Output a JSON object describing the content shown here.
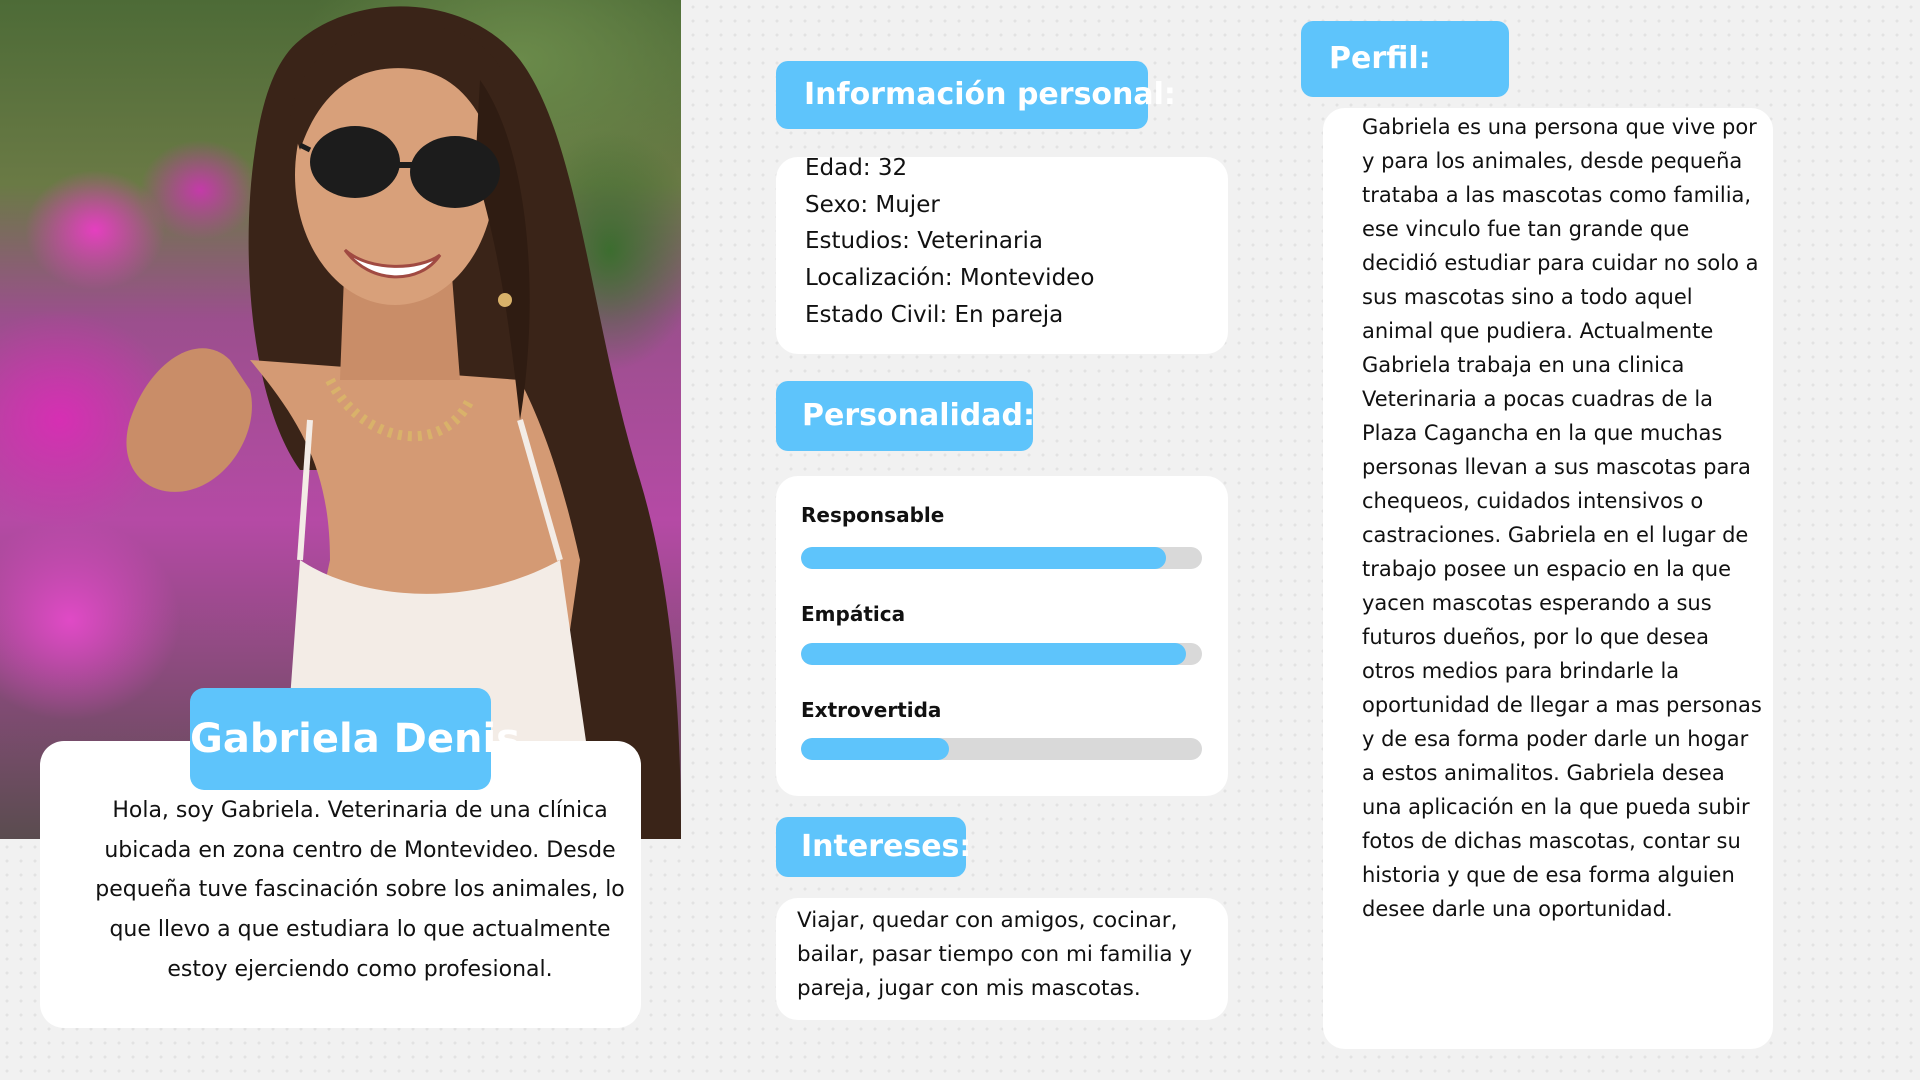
{
  "colors": {
    "accent": "#5ec4fb",
    "card": "#ffffff",
    "bar_track": "#d9d9d9",
    "text": "#111111"
  },
  "name": "Gabriela Denis",
  "bio": "Hola, soy Gabriela. Veterinaria de una clínica ubicada en zona centro de Montevideo. Desde pequeña tuve fascinación sobre los animales, lo que llevo a que estudiara lo que actualmente estoy ejerciendo como profesional.",
  "personal_info": {
    "title": "Información personal:",
    "items": [
      "Edad: 32",
      "Sexo: Mujer",
      "Estudios: Veterinaria",
      "Localización: Montevideo",
      "Estado Civil: En pareja"
    ]
  },
  "personality": {
    "title": "Personalidad:",
    "traits": [
      {
        "label": "Responsable",
        "level": 0.91
      },
      {
        "label": "Empática",
        "level": 0.96
      },
      {
        "label": "Extrovertida",
        "level": 0.37
      }
    ]
  },
  "interests": {
    "title": "Intereses:",
    "text": "Viajar, quedar con amigos, cocinar, bailar, pasar tiempo con mi familia y pareja, jugar con mis mascotas."
  },
  "profile": {
    "title": "Perfil:",
    "text": "Gabriela es una persona que vive por y para los animales, desde pequeña trataba a las mascotas como familia, ese vinculo fue tan grande que decidió estudiar para cuidar no solo a sus mascotas sino a todo aquel animal que pudiera. Actualmente Gabriela trabaja en una clinica Veterinaria a pocas cuadras de la Plaza Cagancha en la que muchas personas llevan a sus mascotas para chequeos, cuidados intensivos o castraciones. Gabriela en el lugar de trabajo posee un espacio en la que yacen mascotas esperando a sus futuros dueños, por lo que desea otros medios para brindarle la oportunidad de llegar a mas personas y de esa forma poder darle un hogar a estos animalitos. Gabriela desea una aplicación en la que pueda subir fotos de dichas mascotas, contar su historia y que de esa forma alguien desee darle una oportunidad."
  }
}
